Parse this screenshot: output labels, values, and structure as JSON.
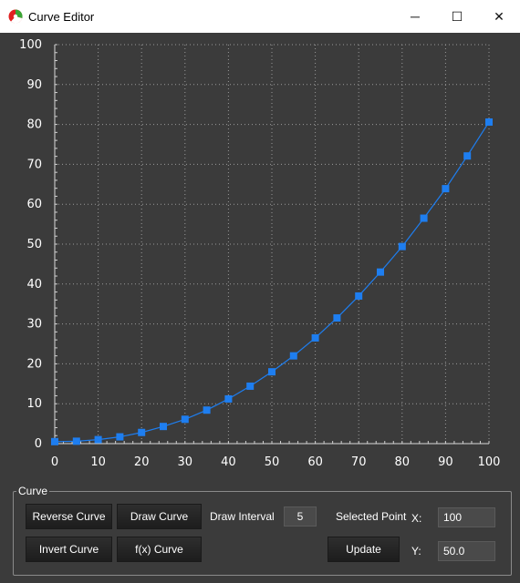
{
  "window": {
    "title": "Curve Editor",
    "controls": {
      "minimize": "─",
      "maximize": "☐",
      "close": "✕"
    }
  },
  "chart_data": {
    "type": "line",
    "title": "",
    "xlabel": "",
    "ylabel": "",
    "xlim": [
      0,
      100
    ],
    "ylim": [
      0,
      100
    ],
    "x_ticks": [
      0,
      10,
      20,
      30,
      40,
      50,
      60,
      70,
      80,
      90,
      100
    ],
    "y_ticks": [
      0,
      10,
      20,
      30,
      40,
      50,
      60,
      70,
      80,
      90,
      100
    ],
    "grid": true,
    "series": [
      {
        "x": [
          0,
          5,
          10,
          15,
          20,
          25,
          30,
          35,
          40,
          45,
          50,
          55,
          60,
          65,
          70,
          75,
          80,
          85,
          90,
          95,
          100
        ],
        "y": [
          0.5,
          0.6,
          1.0,
          1.7,
          2.8,
          4.3,
          6.1,
          8.4,
          11.2,
          14.4,
          18.0,
          22.0,
          26.5,
          31.5,
          37.0,
          43.0,
          49.4,
          56.5,
          63.9,
          72.1,
          80.6
        ],
        "color": "#1e7ef0",
        "marker": "square"
      }
    ]
  },
  "curve_panel": {
    "legend": "Curve",
    "reverse_curve_label": "Reverse Curve",
    "draw_curve_label": "Draw Curve",
    "draw_interval_label": "Draw Interval",
    "draw_interval_value": "5",
    "selected_point_label": "Selected Point",
    "x_label": "X:",
    "x_value": "100",
    "invert_curve_label": "Invert Curve",
    "fx_curve_label": "f(x) Curve",
    "update_label": "Update",
    "y_label": "Y:",
    "y_value": "50.0"
  },
  "colors": {
    "background": "#3b3b3b",
    "plot_background": "#3b3b3b",
    "curve": "#1e7ef0",
    "grid": "#9a9a9a"
  }
}
